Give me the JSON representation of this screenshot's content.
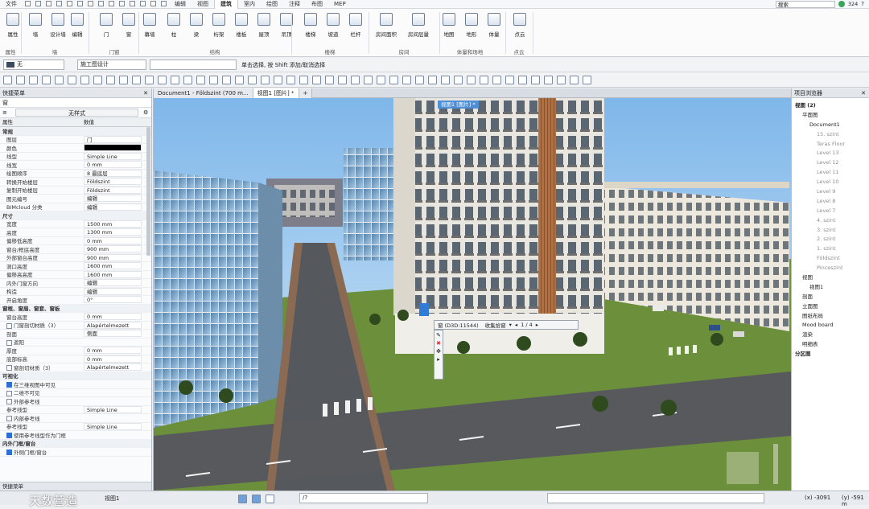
{
  "menubar": {
    "items": [
      "文件",
      "",
      "",
      "",
      "",
      "",
      "",
      "",
      "",
      "",
      "",
      "",
      "",
      "",
      "",
      "编辑",
      "视图",
      "建筑",
      "室内",
      "绘图",
      "注释",
      "布图",
      "MEP"
    ],
    "active_index": 17,
    "search_label": "搜索",
    "user_count": "324"
  },
  "ribbon": {
    "buttons": [
      "属性",
      "墙",
      "设计墙",
      "编辑",
      "门",
      "窗",
      "幕墙",
      "柱",
      "梁",
      "桁架",
      "楼板",
      "屋顶",
      "吊顶",
      "楼梯",
      "坡道",
      "栏杆",
      "房间面积",
      "房间层量",
      "地图",
      "地形",
      "体量",
      "点云"
    ],
    "groups": [
      "属性",
      "墙",
      "门窗",
      "结构",
      "楼梯",
      "房间",
      "体量和场地",
      "点云"
    ]
  },
  "toolbar1": {
    "layer_value": "无",
    "view_value": "施工图设计",
    "status_hint": "单击选择, 按 Shift 添加/取消选择"
  },
  "left_panel": {
    "title": "快捷菜单",
    "filter": "窗",
    "style_btn": "无样式",
    "col_property": "属性",
    "col_value": "数值",
    "rows": [
      {
        "t": "sec",
        "k": "常规"
      },
      {
        "k": "图层",
        "v": "门"
      },
      {
        "k": "颜色",
        "v": "",
        "swatch": "#000000"
      },
      {
        "k": "线型",
        "v": "Simple Line"
      },
      {
        "k": "线宽",
        "v": "0 mm"
      },
      {
        "k": "绘图顺序",
        "v": "8 最底层"
      },
      {
        "k": "转换开始楼层",
        "v": "Földszint"
      },
      {
        "k": "复制开始楼层",
        "v": "Földszint"
      },
      {
        "k": "图元编号",
        "v": "编辑"
      },
      {
        "k": "BIMcloud 分类",
        "v": "编辑"
      },
      {
        "t": "sec",
        "k": "尺寸"
      },
      {
        "k": "宽度",
        "v": "1500 mm"
      },
      {
        "k": "高度",
        "v": "1300 mm"
      },
      {
        "k": "偏移低高度",
        "v": "0 mm"
      },
      {
        "k": "窗台/框底高度",
        "v": "900 mm"
      },
      {
        "k": "外部窗台高度",
        "v": "900 mm"
      },
      {
        "k": "洞口高度",
        "v": "1600 mm"
      },
      {
        "k": "偏移高高度",
        "v": "1600 mm"
      },
      {
        "k": "内外门窗方向",
        "v": "编辑"
      },
      {
        "k": "构造",
        "v": "编辑"
      },
      {
        "k": "开启角度",
        "v": "0°"
      },
      {
        "t": "sec",
        "k": "窗框、窗扇、窗套、窗板"
      },
      {
        "k": "窗台高度",
        "v": "0 mm"
      },
      {
        "k": "门窗剖切材质（3）",
        "v": "Alapértelmezett",
        "cb": false
      },
      {
        "k": "剖面",
        "v": "侧面"
      },
      {
        "k": "遮阳",
        "cb": false
      },
      {
        "k": "厚度",
        "v": "0 mm"
      },
      {
        "k": "底部标高",
        "v": "0 mm"
      },
      {
        "k": "窗剖切材质（3）",
        "v": "Alapértelmezett",
        "cb": false
      },
      {
        "t": "sec",
        "k": "可视化"
      },
      {
        "k": "在三维视图中可见",
        "cb": true
      },
      {
        "k": "二维不可见",
        "cb": false
      },
      {
        "k": "外部参考线",
        "cb": false
      },
      {
        "k": "参考线型",
        "v": "Simple Line"
      },
      {
        "k": "内部参考线",
        "cb": false
      },
      {
        "k": "参考线型",
        "v": "Simple Line"
      },
      {
        "k": "使用参考线型作为门框",
        "cb": true
      },
      {
        "t": "sec",
        "k": "内外门框/窗台"
      },
      {
        "k": "外侧门框/窗台",
        "cb": true
      }
    ],
    "footer": "快捷菜单"
  },
  "viewport": {
    "tabs": [
      "Document1 - Földszint (700 m...",
      "视图1 [图片] *",
      "+"
    ],
    "inner_tab": "视图1 [图片] *",
    "popup_label": "窗 (D3D:11544)",
    "popup_action": "收集拾窗",
    "popup_page": "1 / 4"
  },
  "right_panel": {
    "title": "项目浏览器",
    "items": [
      {
        "lvl": 0,
        "t": "视图 (2)"
      },
      {
        "lvl": 1,
        "t": "平面图"
      },
      {
        "lvl": 2,
        "t": "Document1"
      },
      {
        "lvl": 3,
        "t": "15. szint"
      },
      {
        "lvl": 3,
        "t": "Teras Floor"
      },
      {
        "lvl": 3,
        "t": "Level 13"
      },
      {
        "lvl": 3,
        "t": "Level 12"
      },
      {
        "lvl": 3,
        "t": "Level 11"
      },
      {
        "lvl": 3,
        "t": "Level 10"
      },
      {
        "lvl": 3,
        "t": "Level 9"
      },
      {
        "lvl": 3,
        "t": "Level 8"
      },
      {
        "lvl": 3,
        "t": "Level 7"
      },
      {
        "lvl": 3,
        "t": "4. szint"
      },
      {
        "lvl": 3,
        "t": "3. szint"
      },
      {
        "lvl": 3,
        "t": "2. szint"
      },
      {
        "lvl": 3,
        "t": "1. szint"
      },
      {
        "lvl": 3,
        "t": "Földszint"
      },
      {
        "lvl": 3,
        "t": "Pinceszint"
      },
      {
        "lvl": 1,
        "t": "视图"
      },
      {
        "lvl": 2,
        "t": "视图1"
      },
      {
        "lvl": 1,
        "t": "剖面"
      },
      {
        "lvl": 1,
        "t": "立面图"
      },
      {
        "lvl": 1,
        "t": "图纸布局"
      },
      {
        "lvl": 1,
        "t": "Mood board"
      },
      {
        "lvl": 1,
        "t": "渲染"
      },
      {
        "lvl": 1,
        "t": "明细表"
      },
      {
        "lvl": 0,
        "t": "分区图"
      }
    ]
  },
  "status": {
    "view_name": "视图1",
    "cmd": "/?",
    "coord_x": "(x) -3091",
    "coord_y": "(y) -591 m",
    "watermark": "天数营造"
  }
}
